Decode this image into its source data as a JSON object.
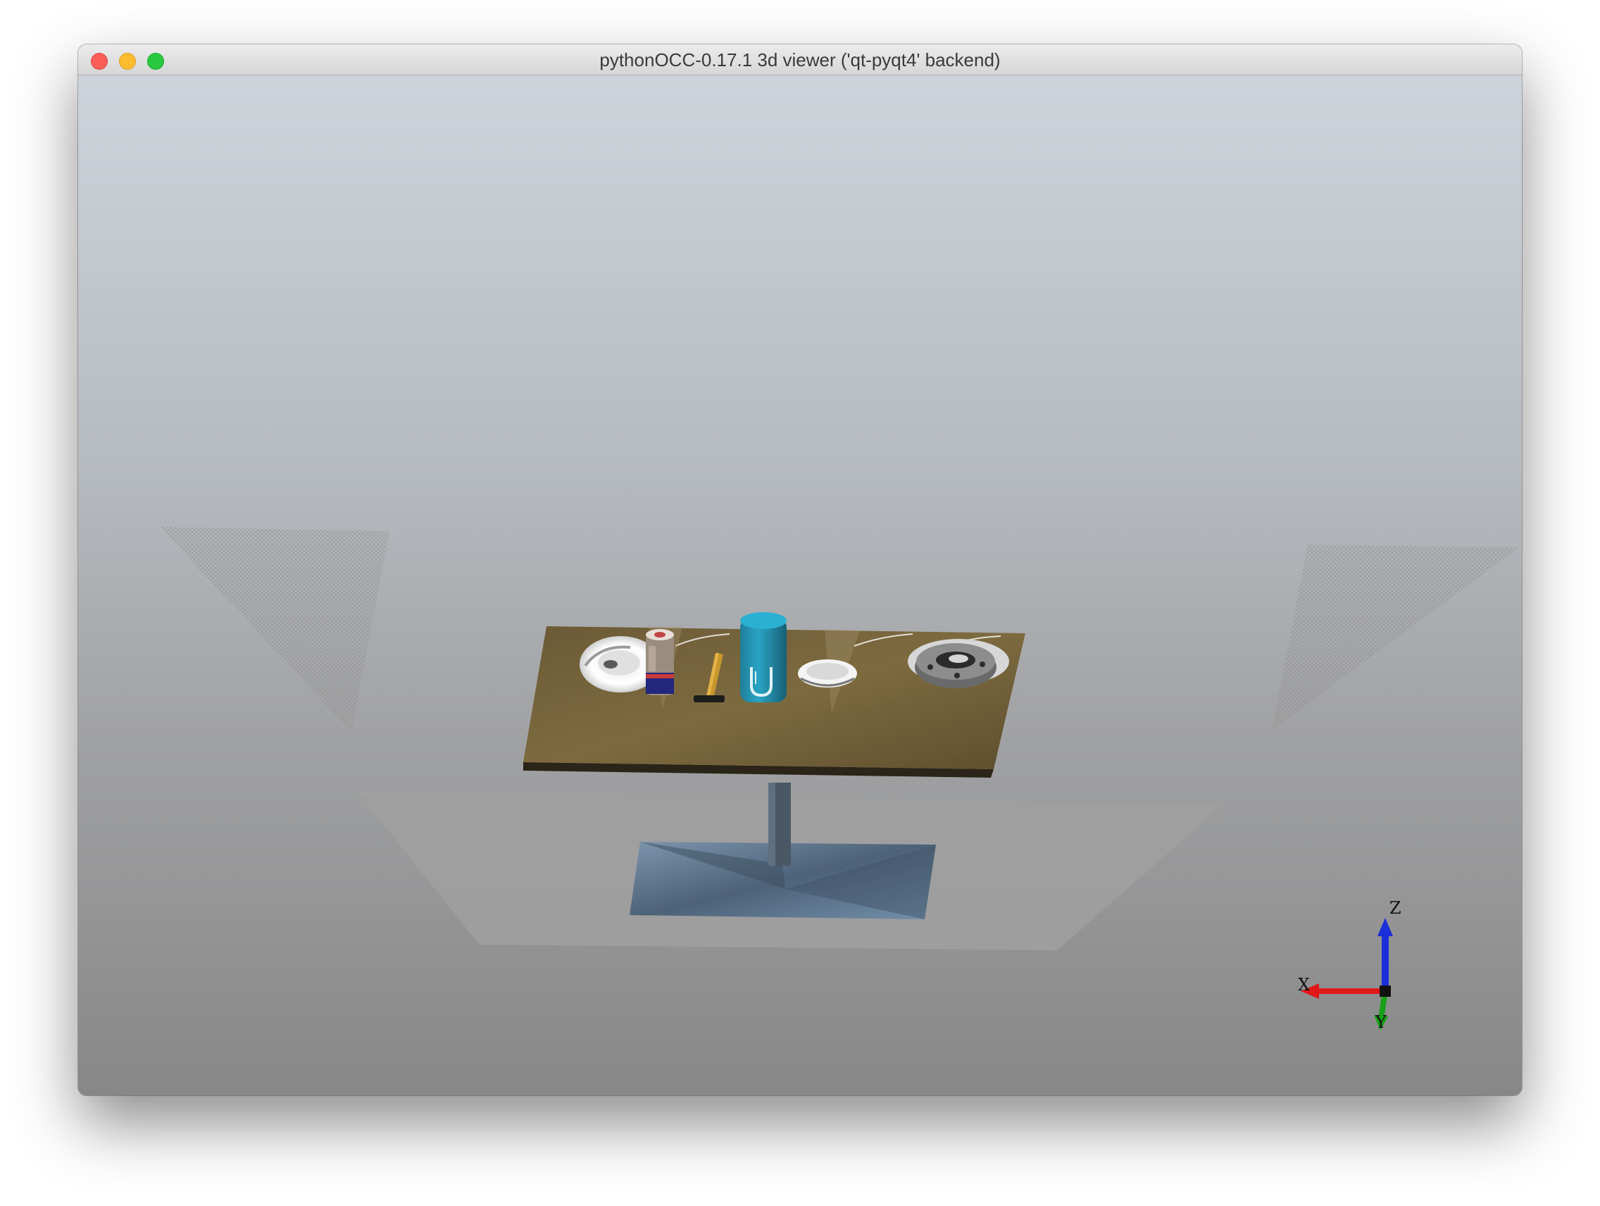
{
  "window": {
    "title": "pythonOCC-0.17.1 3d viewer ('qt-pyqt4' backend)"
  },
  "traffic_lights": [
    "close",
    "minimize",
    "zoom"
  ],
  "scene": {
    "objects": [
      "table",
      "white-plate",
      "jar",
      "hammer",
      "blue-can",
      "white-bowl",
      "grey-flange-part",
      "floor-plane",
      "left-wall-mesh",
      "right-wall-mesh"
    ],
    "background_gradient": [
      "#cdd4db",
      "#878787"
    ]
  },
  "axis_triad": {
    "z_label": "Z",
    "x_label": "X",
    "y_label": "Y",
    "colors": {
      "z": "#1a2fd8",
      "x": "#e01818",
      "y": "#18a018"
    }
  }
}
